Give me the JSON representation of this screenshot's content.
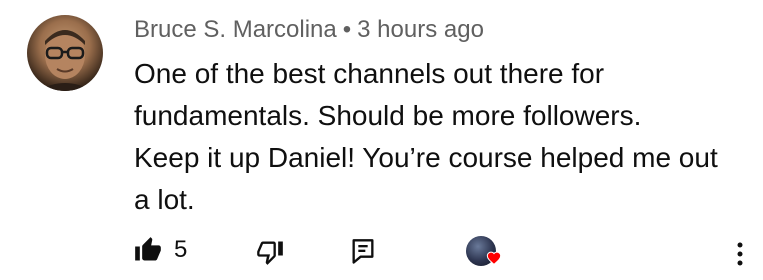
{
  "comment": {
    "author": "Bruce S. Marcolina",
    "separator": "•",
    "timestamp": "3 hours ago",
    "text_lines": [
      "One of the best channels out there for",
      "fundamentals.  Should be more followers.",
      "Keep it up Daniel!  You’re course helped me out",
      "a lot."
    ],
    "like_count": "5",
    "hearted_by_creator": true
  },
  "icons": {
    "like": "thumbs-up-filled-icon",
    "dislike": "thumbs-down-outline-icon",
    "reply": "reply-comment-icon",
    "creator_heart": "creator-heart-badge-icon",
    "more": "more-vertical-icon"
  },
  "colors": {
    "meta_text": "#606060",
    "body_text": "#0f0f0f",
    "heart": "#ff0000"
  }
}
